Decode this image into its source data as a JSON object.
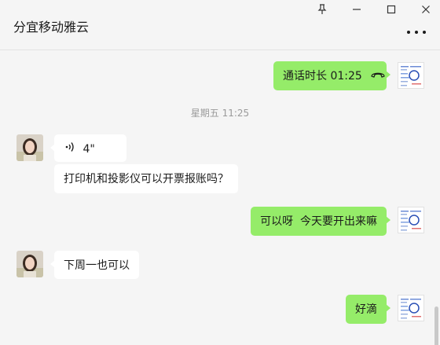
{
  "window": {
    "controls": [
      {
        "name": "pin-icon"
      },
      {
        "name": "minimize-icon"
      },
      {
        "name": "maximize-icon"
      },
      {
        "name": "close-icon"
      }
    ]
  },
  "header": {
    "title": "分宜移动雅云",
    "more_icon": "more-dots-icon"
  },
  "messages": [
    {
      "id": "m1",
      "sender": "me",
      "type": "call",
      "text": "通话时长 01:25",
      "icon": "phone-hangup-icon"
    },
    {
      "id": "t1",
      "type": "timestamp",
      "text": "星期五 11:25"
    },
    {
      "id": "m2",
      "sender": "them",
      "type": "voice",
      "text": "4\"",
      "icon": "voice-wave-icon"
    },
    {
      "id": "m3",
      "sender": "them",
      "type": "text",
      "text": "打印机和投影仪可以开票报账吗？"
    },
    {
      "id": "m4",
      "sender": "me",
      "type": "text",
      "text": "可以呀  今天要开出来嘛"
    },
    {
      "id": "m5",
      "sender": "them",
      "type": "text",
      "text": "下周一也可以"
    },
    {
      "id": "m6",
      "sender": "me",
      "type": "text",
      "text": "好滴"
    }
  ],
  "colors": {
    "background": "#f5f5f5",
    "my_bubble": "#95ec69",
    "their_bubble": "#ffffff",
    "timestamp_text": "#9a9a9a"
  }
}
